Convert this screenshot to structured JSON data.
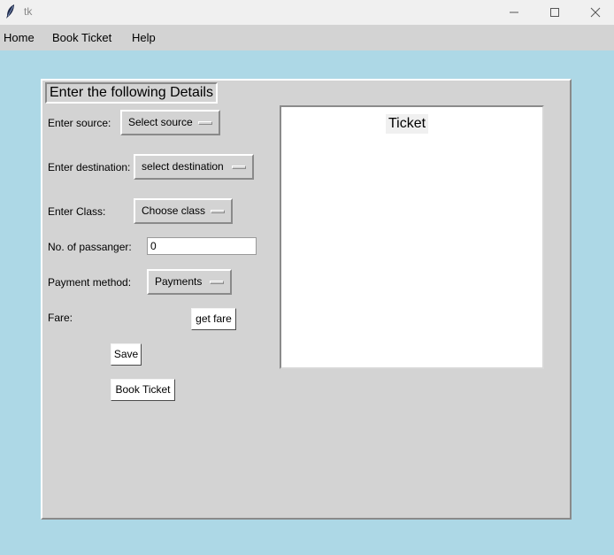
{
  "window": {
    "title": "tk",
    "icon": "feather-icon"
  },
  "menu": {
    "items": [
      "Home",
      "Book Ticket",
      "Help"
    ]
  },
  "form": {
    "heading": "Enter the following Details",
    "source_label": "Enter source:",
    "source_value": "Select source",
    "destination_label": "Enter destination:",
    "destination_value": "select destination",
    "class_label": "Enter Class:",
    "class_value": "Choose class",
    "passengers_label": "No. of passanger:",
    "passengers_value": "0",
    "payment_label": "Payment method:",
    "payment_value": "Payments",
    "fare_label": "Fare:",
    "get_fare_button": "get fare",
    "save_button": "Save",
    "book_button": "Book Ticket"
  },
  "ticket": {
    "title": "Ticket"
  },
  "colors": {
    "background": "#add8e6",
    "frame": "#d3d3d3",
    "panel": "#ffffff"
  }
}
